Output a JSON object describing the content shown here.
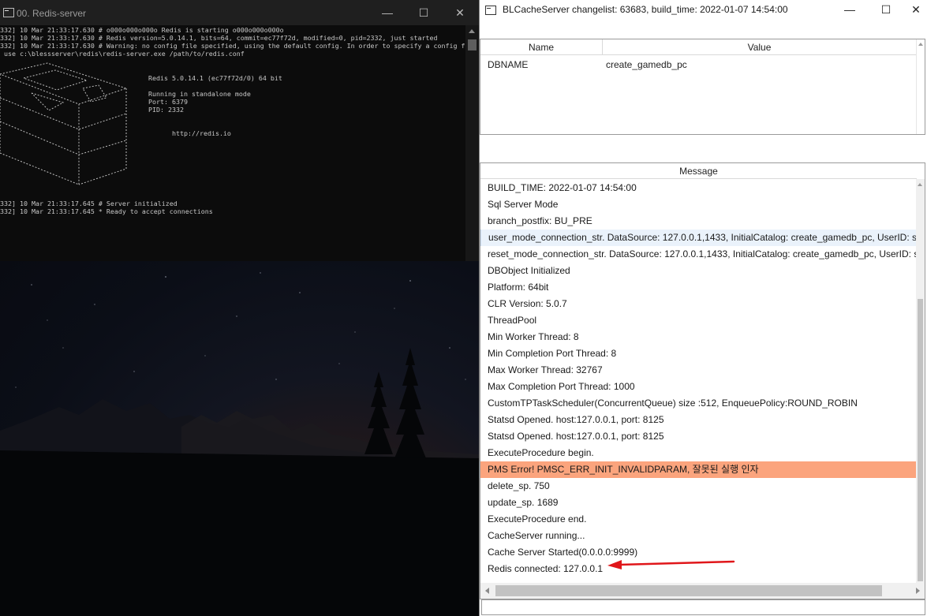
{
  "console": {
    "title": "00. Redis-server",
    "controls": {
      "minimize": "—",
      "maximize": "☐",
      "close": "✕"
    },
    "log_top": [
      "332] 10 Mar 21:33:17.630 # o000o000o000o Redis is starting o000o000o000o",
      "332] 10 Mar 21:33:17.630 # Redis version=5.0.14.1, bits=64, commit=ec77f72d, modified=0, pid=2332, just started",
      "332] 10 Mar 21:33:17.630 # Warning: no config file specified, using the default config. In order to specify a config f",
      " use c:\\blessserver\\redis\\redis-server.exe /path/to/redis.conf"
    ],
    "banner": {
      "version_line": "Redis 5.0.14.1 (ec77f72d/0) 64 bit",
      "mode_line": "Running in standalone mode",
      "port_line": "Port: 6379",
      "pid_line": "PID: 2332",
      "url_line": "http://redis.io"
    },
    "log_bottom": [
      "332] 10 Mar 21:33:17.645 # Server initialized",
      "332] 10 Mar 21:33:17.645 * Ready to accept connections"
    ]
  },
  "app": {
    "title": "BLCacheServer changelist: 63683, build_time: 2022-01-07 14:54:00",
    "controls": {
      "minimize": "—",
      "maximize": "☐",
      "close": "✕"
    },
    "kv_grid": {
      "col_name": "Name",
      "col_value": "Value",
      "rows": [
        {
          "name": "DBNAME",
          "value": "create_gamedb_pc"
        }
      ]
    },
    "messages": {
      "header": "Message",
      "items": [
        "BUILD_TIME: 2022-01-07 14:54:00",
        "Sql Server Mode",
        "branch_postfix: BU_PRE",
        "user_mode_connection_str. DataSource: 127.0.0.1,1433, InitialCatalog: create_gamedb_pc, UserID: sa, Max",
        "reset_mode_connection_str. DataSource: 127.0.0.1,1433, InitialCatalog: create_gamedb_pc, UserID: sa, Max",
        "DBObject Initialized",
        "Platform: 64bit",
        "CLR Version: 5.0.7",
        "ThreadPool",
        "Min Worker Thread: 8",
        "Min Completion Port Thread: 8",
        "Max Worker Thread: 32767",
        "Max Completion Port Thread: 1000",
        "CustomTPTaskScheduler(ConcurrentQueue) size :512, EnqueuePolicy:ROUND_ROBIN",
        "Statsd Opened. host:127.0.0.1, port: 8125",
        "Statsd Opened. host:127.0.0.1, port: 8125",
        "ExecuteProcedure begin.",
        "PMS Error! PMSC_ERR_INIT_INVALIDPARAM, 잘못된 실행 인자",
        "delete_sp. 750",
        "update_sp. 1689",
        "ExecuteProcedure end.",
        "CacheServer running...",
        "Cache Server Started(0.0.0.0:9999)",
        "Redis connected: 127.0.0.1"
      ],
      "selected_index": 3,
      "error_index": 17
    },
    "command_input": {
      "value": ""
    },
    "colors": {
      "error_row": "#fba47d",
      "annotation_arrow": "#e0161a"
    }
  }
}
